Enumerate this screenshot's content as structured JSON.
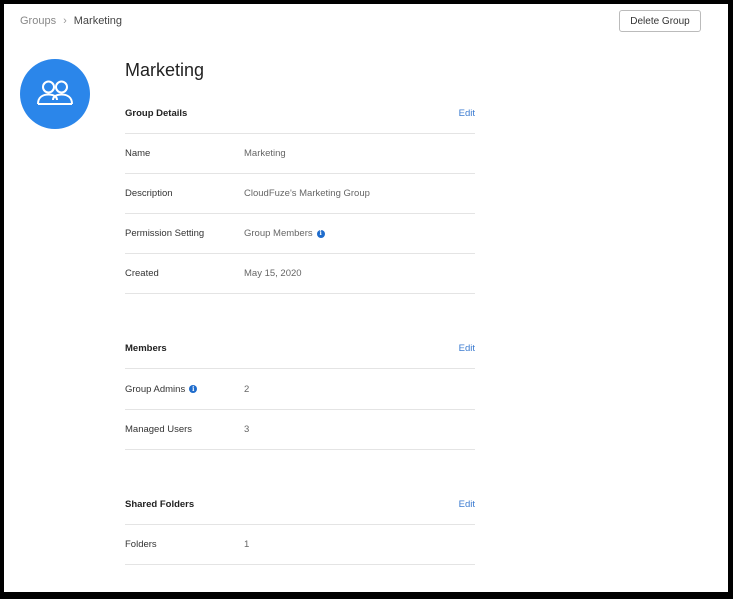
{
  "breadcrumb": {
    "parent": "Groups",
    "separator": "›",
    "current": "Marketing"
  },
  "toolbar": {
    "delete_label": "Delete Group"
  },
  "avatar": {
    "icon": "group-icon",
    "color": "#2b86ea"
  },
  "group": {
    "title": "Marketing"
  },
  "sections": {
    "details": {
      "title": "Group Details",
      "edit": "Edit",
      "rows": [
        {
          "label": "Name",
          "value": "Marketing"
        },
        {
          "label": "Description",
          "value": "CloudFuze's Marketing Group"
        },
        {
          "label": "Permission Setting",
          "value": "Group Members"
        },
        {
          "label": "Created",
          "value": "May 15, 2020"
        }
      ]
    },
    "members": {
      "title": "Members",
      "edit": "Edit",
      "rows": [
        {
          "label": "Group Admins",
          "value": "2"
        },
        {
          "label": "Managed Users",
          "value": "3"
        }
      ]
    },
    "folders": {
      "title": "Shared Folders",
      "edit": "Edit",
      "rows": [
        {
          "label": "Folders",
          "value": "1"
        }
      ]
    }
  },
  "info_icon_glyph": "i",
  "accent_color": "#3b7bd0"
}
